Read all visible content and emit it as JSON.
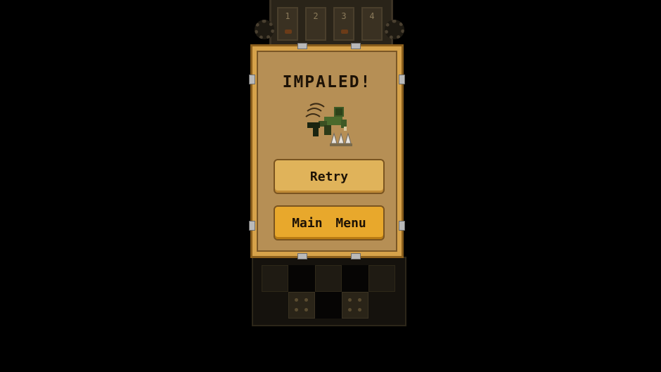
{
  "dialog": {
    "title": "IMPALED!",
    "buttons": {
      "retry_label": "Retry",
      "main_menu_label": "Main Menu"
    }
  },
  "doors": [
    {
      "number": "1"
    },
    {
      "number": "2"
    },
    {
      "number": "3"
    },
    {
      "number": "4"
    }
  ],
  "colors": {
    "panel": "#d6a24a",
    "panel_inner": "#b68f55",
    "button": "#e0b35a",
    "button_highlight": "#e8a82c",
    "text": "#1d1206"
  },
  "icons": [
    "impaled-character-icon",
    "gear-icon",
    "spikes-icon"
  ]
}
